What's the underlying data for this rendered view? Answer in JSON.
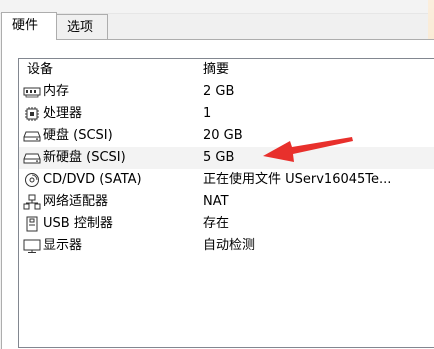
{
  "tabs": [
    {
      "label": "硬件",
      "active": true
    },
    {
      "label": "选项",
      "active": false
    }
  ],
  "list": {
    "headers": {
      "device": "设备",
      "summary": "摘要"
    },
    "rows": [
      {
        "icon": "memory-icon",
        "name": "内存",
        "summary": "2 GB"
      },
      {
        "icon": "processor-icon",
        "name": "处理器",
        "summary": "1"
      },
      {
        "icon": "hard-disk-icon",
        "name": "硬盘 (SCSI)",
        "summary": "20 GB"
      },
      {
        "icon": "hard-disk-icon",
        "name": "新硬盘 (SCSI)",
        "summary": "5 GB",
        "selected": true
      },
      {
        "icon": "cd-dvd-icon",
        "name": "CD/DVD (SATA)",
        "summary": "正在使用文件 UServ16045Te..."
      },
      {
        "icon": "network-adapter-icon",
        "name": "网络适配器",
        "summary": "NAT"
      },
      {
        "icon": "usb-icon",
        "name": "USB 控制器",
        "summary": "存在"
      },
      {
        "icon": "display-icon",
        "name": "显示器",
        "summary": "自动检测"
      }
    ]
  },
  "colors": {
    "arrow": "#e8302c",
    "selected_row": "#f3f3f3"
  }
}
